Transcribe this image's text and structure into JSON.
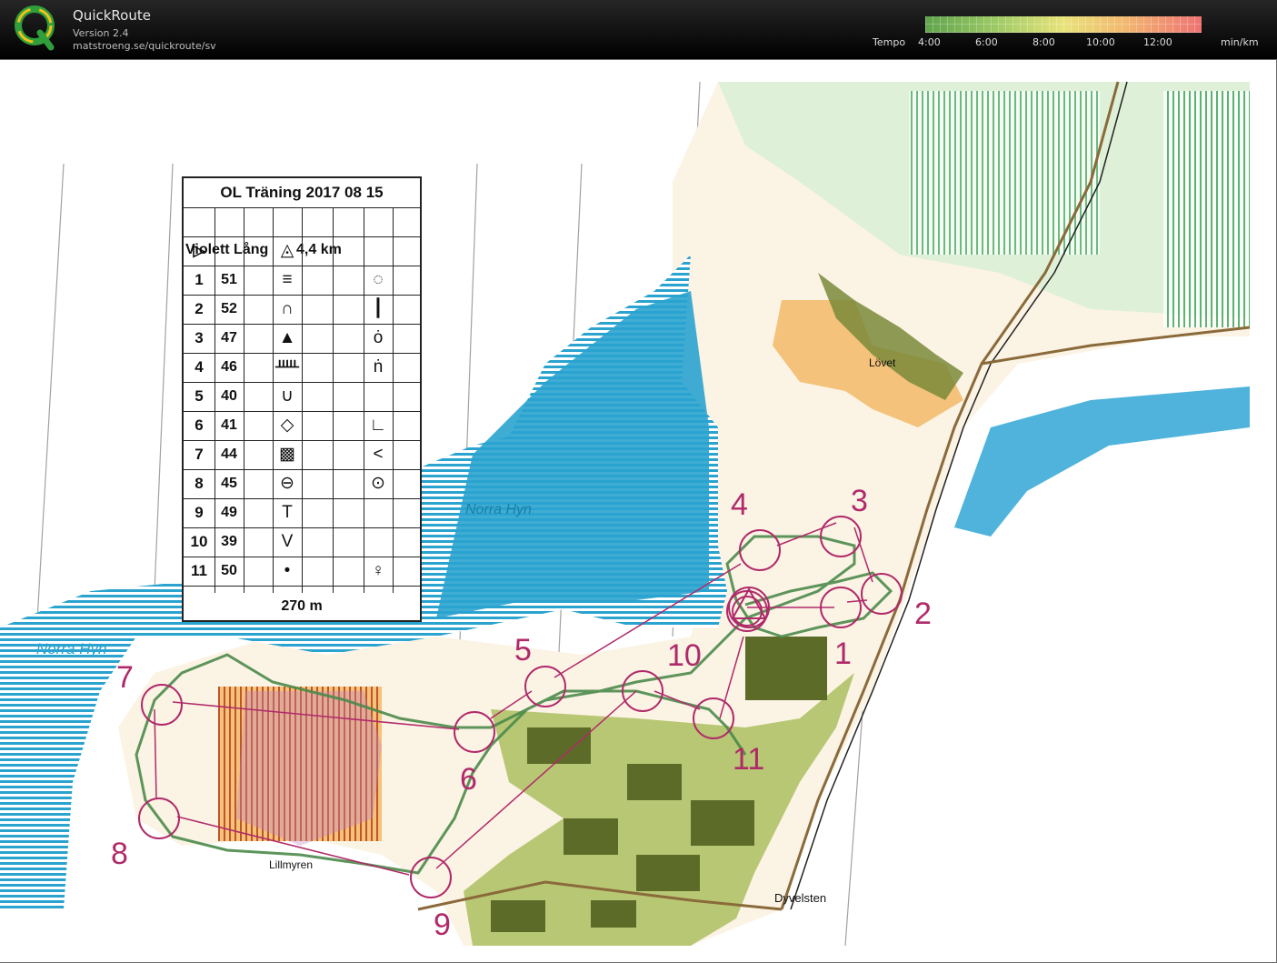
{
  "app": {
    "title": "QuickRoute",
    "version": "Version 2.4",
    "url": "matstroeng.se/quickroute/sv"
  },
  "tempo": {
    "label": "Tempo",
    "ticks": [
      "4:00",
      "6:00",
      "8:00",
      "10:00",
      "12:00"
    ],
    "unit": "min/km",
    "colors": [
      "#5fa34c",
      "#9cc964",
      "#e8e37a",
      "#f2b86f",
      "#ee7273"
    ]
  },
  "control_description": {
    "title": "OL Träning 2017 08 15",
    "course": "Violett Lång",
    "length": "4,4 km",
    "start_symbol": "▷",
    "start_feature": "◬",
    "controls": [
      {
        "num": "1",
        "code": "51",
        "feature": "≡",
        "detail": "◌"
      },
      {
        "num": "2",
        "code": "52",
        "feature": "∩",
        "detail": "┃"
      },
      {
        "num": "3",
        "code": "47",
        "feature": "▲",
        "detail": "ȯ"
      },
      {
        "num": "4",
        "code": "46",
        "feature": "ᚊ",
        "detail": "ṅ"
      },
      {
        "num": "5",
        "code": "40",
        "feature": "∪",
        "detail": ""
      },
      {
        "num": "6",
        "code": "41",
        "feature": "◇",
        "detail": "∟"
      },
      {
        "num": "7",
        "code": "44",
        "feature": "▩",
        "detail": "<"
      },
      {
        "num": "8",
        "code": "45",
        "feature": "⊖",
        "detail": "⊙"
      },
      {
        "num": "9",
        "code": "49",
        "feature": "T",
        "detail": ""
      },
      {
        "num": "10",
        "code": "39",
        "feature": "V",
        "detail": ""
      },
      {
        "num": "11",
        "code": "50",
        "feature": "•",
        "detail": "♀"
      }
    ],
    "finish": "270 m"
  },
  "map_labels": {
    "lake_west": "Norra Hyn",
    "lake_center": "Norra Hyn",
    "village_north": "Lövet",
    "place_south": "Lillmyren",
    "place_southeast": "Dyvelsten"
  },
  "control_numbers": [
    "1",
    "2",
    "3",
    "4",
    "5",
    "6",
    "7",
    "8",
    "9",
    "10",
    "11"
  ],
  "colors": {
    "water": "#2aa3cf",
    "course": "#b02a6a",
    "route": "#4a8a4a",
    "buildings": "#7a8a3a",
    "open_land": "#f4c27a"
  }
}
